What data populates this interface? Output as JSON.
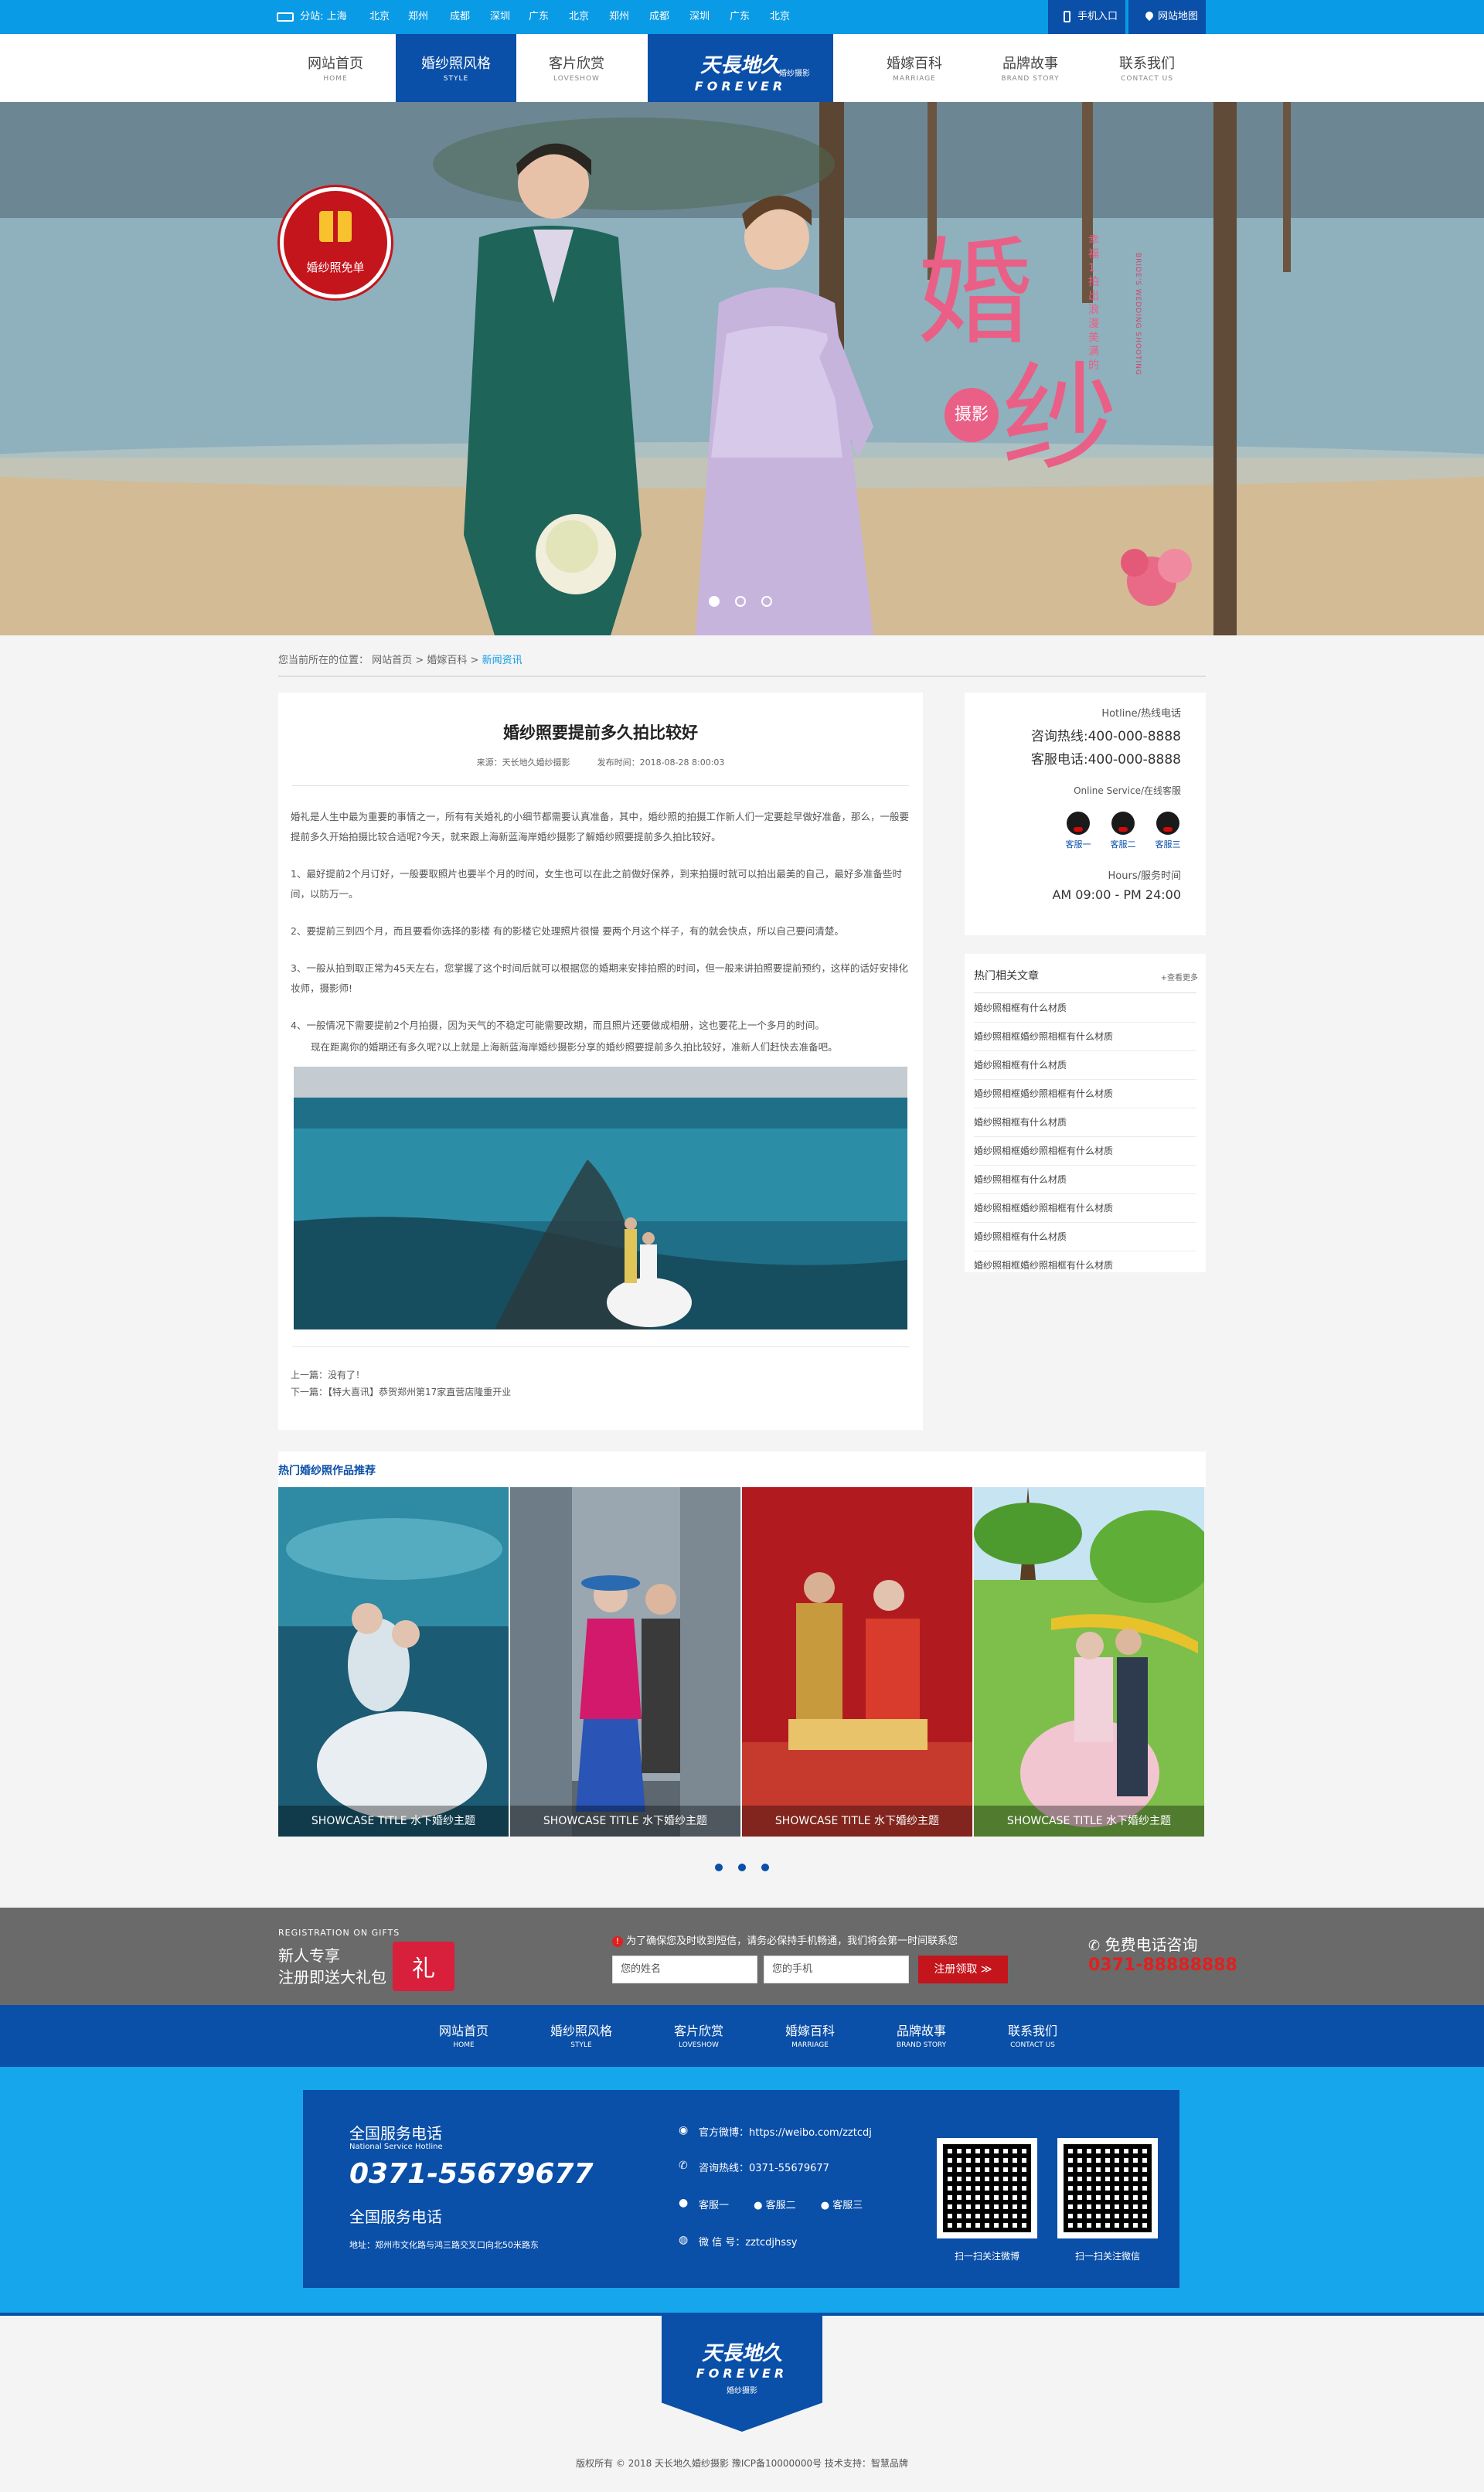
{
  "topbar": {
    "branch_label": "分站: 上海",
    "cities": [
      "北京",
      "郑州",
      "成都",
      "深圳",
      "广东",
      "北京",
      "郑州",
      "成都",
      "深圳",
      "广东",
      "北京"
    ],
    "mobile_label": "手机入口",
    "map_label": "网站地图"
  },
  "nav": {
    "left": [
      {
        "zh": "网站首页",
        "en": "HOME"
      },
      {
        "zh": "婚纱照风格",
        "en": "STYLE"
      },
      {
        "zh": "客片欣赏",
        "en": "LOVESHOW"
      }
    ],
    "right": [
      {
        "zh": "婚嫁百科",
        "en": "MARRIAGE"
      },
      {
        "zh": "品牌故事",
        "en": "BRAND STORY"
      },
      {
        "zh": "联系我们",
        "en": "CONTACT US"
      }
    ],
    "logo": {
      "zh": "天長地久",
      "en": "FOREVER",
      "tag": "婚纱摄影"
    }
  },
  "hero": {
    "badge": "婚纱照免单",
    "title_a": "婚",
    "title_b": "纱",
    "title_c": "摄影",
    "subtitle": "幸福1拍出浪漫美满的",
    "subtitle_en": "BRIDE'S WEDDING SHOOTING"
  },
  "breadcrumb": {
    "prefix": "您当前所在的位置：",
    "home": "网站首页",
    "sep": ">",
    "level1": "婚嫁百科",
    "current": "新闻资讯"
  },
  "article": {
    "title": "婚纱照要提前多久拍比较好",
    "source": "来源：天长地久婚纱摄影",
    "time": "发布时间：2018-08-28 8:00:03",
    "paragraphs": [
      "婚礼是人生中最为重要的事情之一，所有有关婚礼的小细节都需要认真准备，其中，婚纱照的拍摄工作新人们一定要趁早做好准备，那么，一般要提前多久开始拍摄比较合适呢?今天，就来跟上海新蓝海岸婚纱摄影了解婚纱照要提前多久拍比较好。",
      "1、最好提前2个月订好，一般要取照片也要半个月的时间，女生也可以在此之前做好保养，到来拍摄时就可以拍出最美的自己，最好多准备些时间，以防万一。",
      "2、要提前三到四个月，而且要看你选择的影楼 有的影楼它处理照片很慢 要两个月这个样子，有的就会快点，所以自己要问清楚。",
      "3、一般从拍到取正常为45天左右，您掌握了这个时间后就可以根据您的婚期来安排拍照的时间，但一般来讲拍照要提前预约，这样的话好安排化妆师，摄影师!",
      "4、一般情况下需要提前2个月拍摄，因为天气的不稳定可能需要改期，而且照片还要做成相册，这也要花上一个多月的时间。",
      "现在距离你的婚期还有多久呢?以上就是上海新蓝海岸婚纱摄影分享的婚纱照要提前多久拍比较好，准新人们赶快去准备吧。"
    ],
    "prev": "上一篇：没有了！",
    "next": "下一篇：【特大喜讯】恭贺郑州第17家直营店隆重开业"
  },
  "sidebar": {
    "hotline_label": "Hotline/热线电话",
    "consult_phone": "咨询热线:400-000-8888",
    "service_phone": "客服电话:400-000-8888",
    "online_label": "Online Service/在线客服",
    "agents": [
      "客服一",
      "客服二",
      "客服三"
    ],
    "hours_label": "Hours/服务时间",
    "hours": "AM 09:00 - PM 24:00",
    "hot_title": "热门相关文章",
    "hot_more": "+查看更多",
    "hot_items": [
      "婚纱照相框有什么材质",
      "婚纱照相框婚纱照相框有什么材质",
      "婚纱照相框有什么材质",
      "婚纱照相框婚纱照相框有什么材质",
      "婚纱照相框有什么材质",
      "婚纱照相框婚纱照相框有什么材质",
      "婚纱照相框有什么材质",
      "婚纱照相框婚纱照相框有什么材质",
      "婚纱照相框有什么材质",
      "婚纱照相框婚纱照相框有什么材质"
    ]
  },
  "recommend": {
    "title": "热门婚纱照作品推荐",
    "items": [
      {
        "caption": "SHOWCASE TITLE 水下婚纱主题"
      },
      {
        "caption": "SHOWCASE TITLE 水下婚纱主题"
      },
      {
        "caption": "SHOWCASE TITLE 水下婚纱主题"
      },
      {
        "caption": "SHOWCASE TITLE 水下婚纱主题"
      }
    ]
  },
  "register": {
    "gift_en": "REGISTRATION ON GIFTS",
    "gift_line1": "新人专享",
    "gift_line2": "注册即送大礼包",
    "gift_mark": "礼",
    "notice": "为了确保您及时收到短信，请务必保持手机畅通，我们将会第一时间联系您",
    "name_placeholder": "您的姓名",
    "phone_placeholder": "您的手机",
    "button": "注册领取 ≫",
    "free_label": "免费电话咨询",
    "free_phone": "0371-88888888"
  },
  "footer_nav": [
    {
      "zh": "网站首页",
      "en": "HOME"
    },
    {
      "zh": "婚纱照风格",
      "en": "STYLE"
    },
    {
      "zh": "客片欣赏",
      "en": "LOVESHOW"
    },
    {
      "zh": "婚嫁百科",
      "en": "MARRIAGE"
    },
    {
      "zh": "品牌故事",
      "en": "BRAND STORY"
    },
    {
      "zh": "联系我们",
      "en": "CONTACT US"
    }
  ],
  "footer": {
    "service_title": "全国服务电话",
    "service_en": "National Service Hotline",
    "phone": "0371-55679677",
    "service_title2": "全国服务电话",
    "address": "地址：郑州市文化路与鸿三路交叉口向北50米路东",
    "weibo": "官方微博：https://weibo.com/zztcdj",
    "consult": "咨询热线：0371-55679677",
    "agents": [
      "客服一",
      "客服二",
      "客服三"
    ],
    "wechat": "微 信 号：zztcdjhssy",
    "qr_weibo": "扫一扫关注微博",
    "qr_wechat": "扫一扫关注微信"
  },
  "copyright": "版权所有 © 2018 天长地久婚纱摄影  豫ICP备10000000号  技术支持：智慧品牌",
  "colors": {
    "dark_blue": "#0a4fa8",
    "light_blue": "#0a9be6",
    "red": "#c4141c"
  }
}
